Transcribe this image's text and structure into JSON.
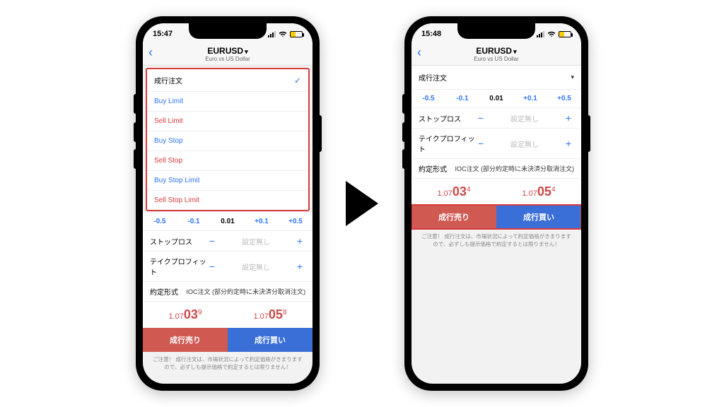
{
  "left": {
    "time": "15:47",
    "symbol": "EURUSD",
    "subtitle": "Euro vs US Dollar",
    "menu": [
      {
        "label": "成行注文",
        "cls": "mi-black",
        "checked": true
      },
      {
        "label": "Buy Limit",
        "cls": "mi-blue",
        "checked": false
      },
      {
        "label": "Sell Limit",
        "cls": "mi-red",
        "checked": false
      },
      {
        "label": "Buy Stop",
        "cls": "mi-blue",
        "checked": false
      },
      {
        "label": "Sell Stop",
        "cls": "mi-red",
        "checked": false
      },
      {
        "label": "Buy Stop Limit",
        "cls": "mi-blue",
        "checked": false
      },
      {
        "label": "Sell Stop Limit",
        "cls": "mi-red",
        "checked": false
      }
    ],
    "qty": {
      "n2": "-0.5",
      "n1": "-0.1",
      "cur": "0.01",
      "p1": "+0.1",
      "p2": "+0.5"
    },
    "sl_label": "ストップロス",
    "tp_label": "テイクプロフィット",
    "placeholder": "設定無し",
    "fillpolicy_label": "約定形式",
    "fillpolicy_value": "IOC注文 (部分約定時に未決済分取消注文)",
    "bid": {
      "a": "1.07",
      "b": "03",
      "c": "9"
    },
    "ask": {
      "a": "1.07",
      "b": "05",
      "c": "8"
    },
    "sell_btn": "成行売り",
    "buy_btn": "成行買い",
    "note": "ご注意！ 成行注文は、市場状況によって約定価格がきまりますので、必ずしも提示価格で約定するとは限りません！"
  },
  "right": {
    "time": "15:48",
    "symbol": "EURUSD",
    "subtitle": "Euro vs US Dollar",
    "ordertype": "成行注文",
    "qty": {
      "n2": "-0.5",
      "n1": "-0.1",
      "cur": "0.01",
      "p1": "+0.1",
      "p2": "+0.5"
    },
    "sl_label": "ストップロス",
    "tp_label": "テイクプロフィット",
    "placeholder": "設定無し",
    "fillpolicy_label": "約定形式",
    "fillpolicy_value": "IOC注文 (部分約定時に未決済分取消注文)",
    "bid": {
      "a": "1.07",
      "b": "03",
      "c": "4"
    },
    "ask": {
      "a": "1.07",
      "b": "05",
      "c": "4"
    },
    "sell_btn": "成行売り",
    "buy_btn": "成行買い",
    "note": "ご注意！ 成行注文は、市場状況によって約定価格がきまりますので、必ずしも提示価格で約定するとは限りません！"
  }
}
